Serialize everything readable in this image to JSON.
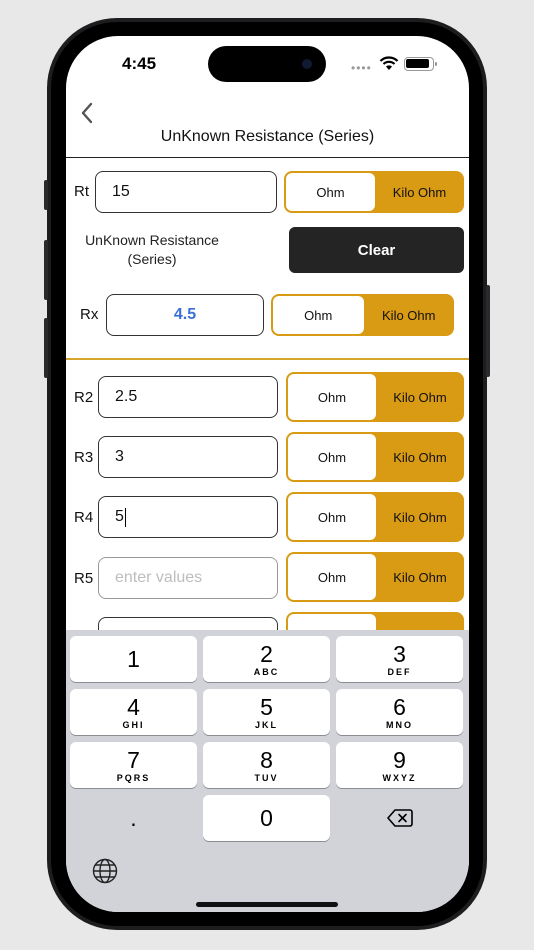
{
  "status": {
    "time": "4:45"
  },
  "nav": {
    "title": "UnKnown Resistance (Series)"
  },
  "unit_options": {
    "ohm": "Ohm",
    "kilo_ohm": "Kilo Ohm"
  },
  "rt": {
    "label": "Rt",
    "value": "15",
    "selected_unit": "Kilo Ohm"
  },
  "description": {
    "line1": "UnKnown Resistance",
    "line2": "(Series)"
  },
  "clear_label": "Clear",
  "rx": {
    "label": "Rx",
    "value": "4.5",
    "selected_unit": "Kilo Ohm"
  },
  "rows": [
    {
      "label": "R2",
      "value": "2.5",
      "selected_unit": "Kilo Ohm"
    },
    {
      "label": "R3",
      "value": "3",
      "selected_unit": "Kilo Ohm"
    },
    {
      "label": "R4",
      "value": "5",
      "selected_unit": "Kilo Ohm"
    },
    {
      "label": "R5",
      "value": "",
      "placeholder": "enter values",
      "selected_unit": "Kilo Ohm"
    }
  ],
  "keyboard": {
    "keys": [
      {
        "num": "1",
        "letters": ""
      },
      {
        "num": "2",
        "letters": "ABC"
      },
      {
        "num": "3",
        "letters": "DEF"
      },
      {
        "num": "4",
        "letters": "GHI"
      },
      {
        "num": "5",
        "letters": "JKL"
      },
      {
        "num": "6",
        "letters": "MNO"
      },
      {
        "num": "7",
        "letters": "PQRS"
      },
      {
        "num": "8",
        "letters": "TUV"
      },
      {
        "num": "9",
        "letters": "WXYZ"
      }
    ],
    "dot": ".",
    "zero": "0"
  },
  "colors": {
    "accent": "#d99a14",
    "result": "#3a6fd8",
    "clear_bg": "#242424"
  }
}
